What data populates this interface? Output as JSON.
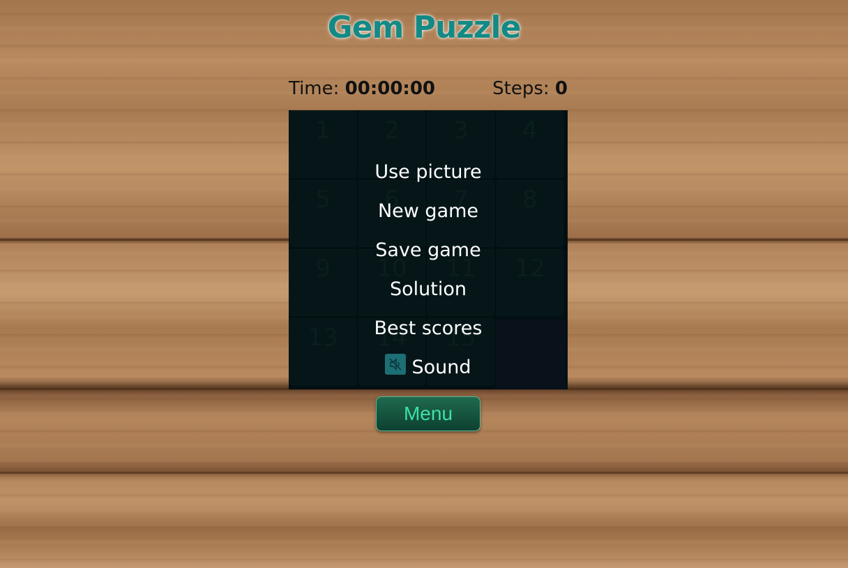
{
  "header": {
    "title": "Gem Puzzle"
  },
  "stats": {
    "time_label": "Time:",
    "time_value": "00:00:00",
    "steps_label": "Steps:",
    "steps_value": "0"
  },
  "board": {
    "tiles": [
      "1",
      "2",
      "3",
      "4",
      "5",
      "6",
      "7",
      "8",
      "9",
      "10",
      "11",
      "12",
      "13",
      "14",
      "15"
    ]
  },
  "menu": {
    "items": [
      "Use picture",
      "New game",
      "Save game",
      "Solution",
      "Best scores"
    ],
    "sound_label": "Sound",
    "sound_icon": "sound-muted-icon",
    "button_label": "Menu"
  },
  "colors": {
    "title": "#138a85",
    "menu_button_text": "#3ee0a6",
    "board_bg": "#05171a"
  }
}
